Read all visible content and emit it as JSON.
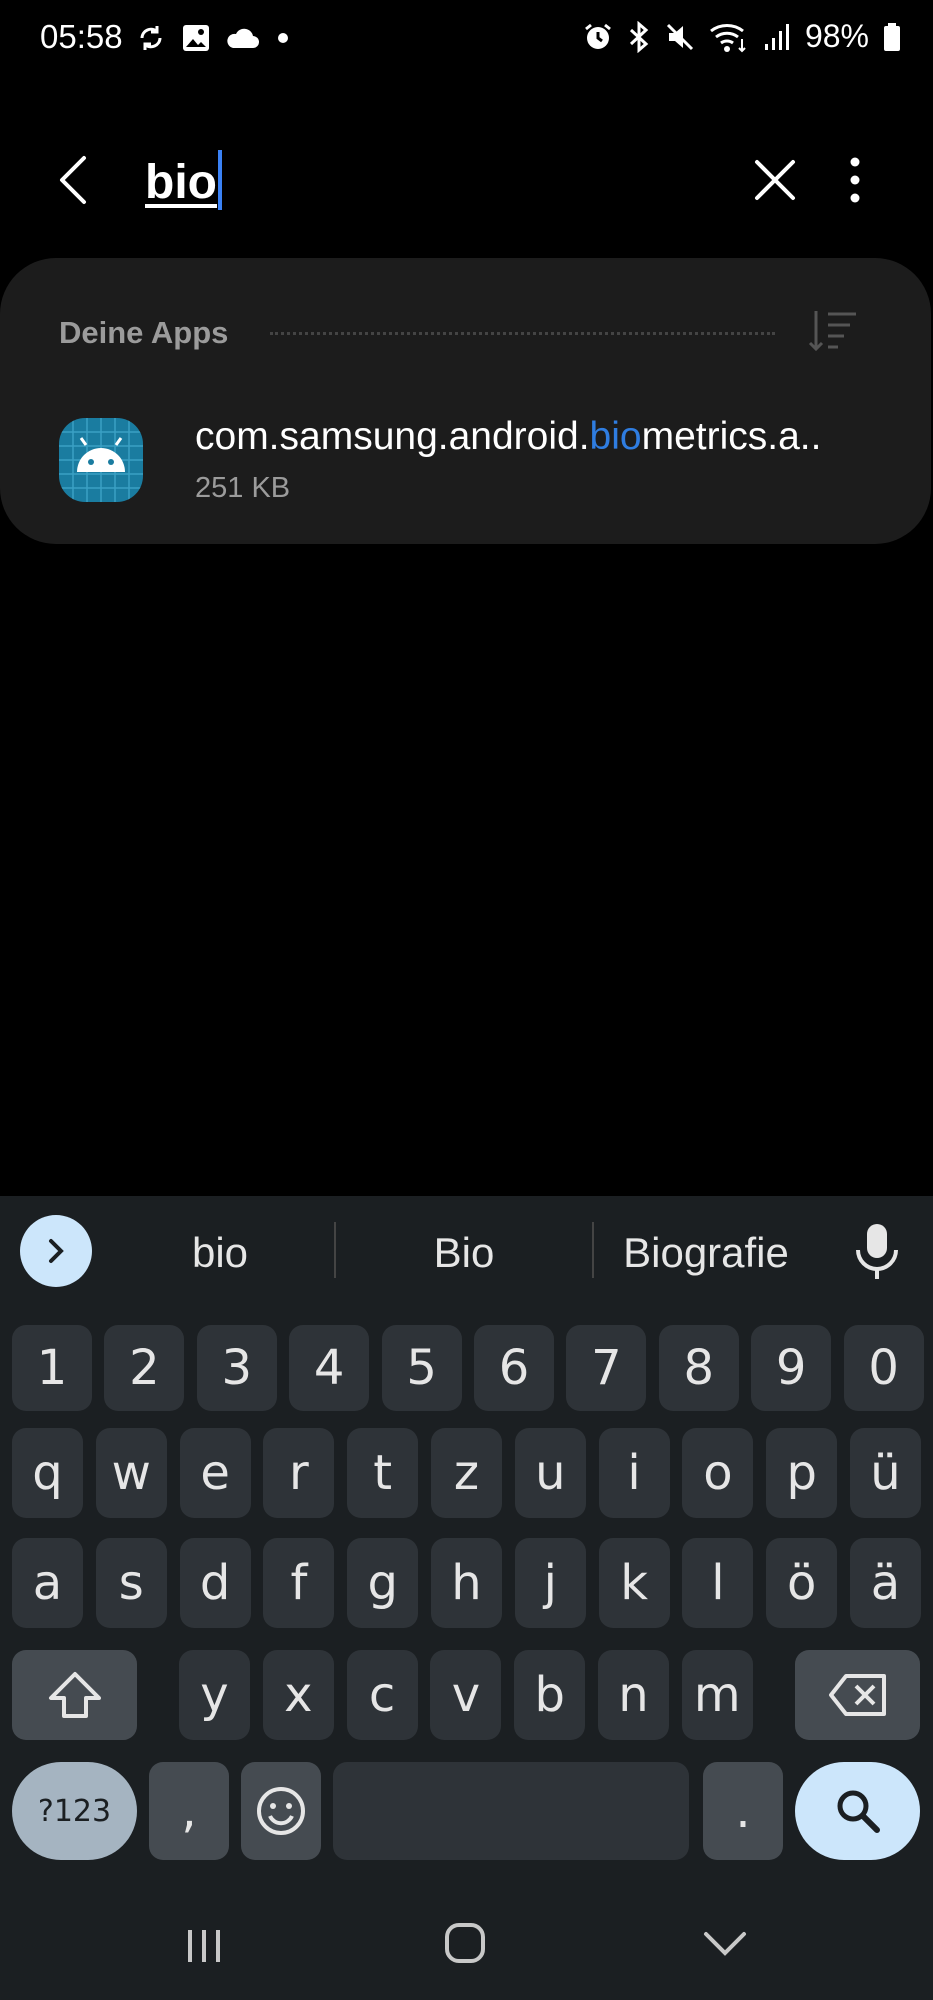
{
  "status_bar": {
    "time": "05:58",
    "left_icons": [
      "sync-icon",
      "image-icon",
      "cloud-icon",
      "dot-icon"
    ],
    "right_icons": [
      "alarm-icon",
      "bluetooth-icon",
      "mute-icon",
      "wifi-icon",
      "signal-icon"
    ],
    "battery": "98%"
  },
  "search": {
    "query": "bio"
  },
  "results": {
    "section_title": "Deine Apps",
    "items": [
      {
        "name_prefix": "com.samsung.android.",
        "name_match": "bio",
        "name_suffix": "metrics.a..",
        "size": "251 KB",
        "icon": "android-icon"
      }
    ]
  },
  "keyboard": {
    "suggestions": [
      "bio",
      "Bio",
      "Biografie"
    ],
    "rows": [
      [
        "1",
        "2",
        "3",
        "4",
        "5",
        "6",
        "7",
        "8",
        "9",
        "0"
      ],
      [
        "q",
        "w",
        "e",
        "r",
        "t",
        "z",
        "u",
        "i",
        "o",
        "p",
        "ü"
      ],
      [
        "a",
        "s",
        "d",
        "f",
        "g",
        "h",
        "j",
        "k",
        "l",
        "ö",
        "ä"
      ],
      [
        "y",
        "x",
        "c",
        "v",
        "b",
        "n",
        "m"
      ]
    ],
    "symbols_label": "?123",
    "comma_label": ",",
    "period_label": "."
  },
  "colors": {
    "accent": "#2f7de1",
    "card_bg": "#1c1c1c",
    "keyboard_bg": "#1b1f22",
    "search_key_bg": "#cce6fb"
  }
}
